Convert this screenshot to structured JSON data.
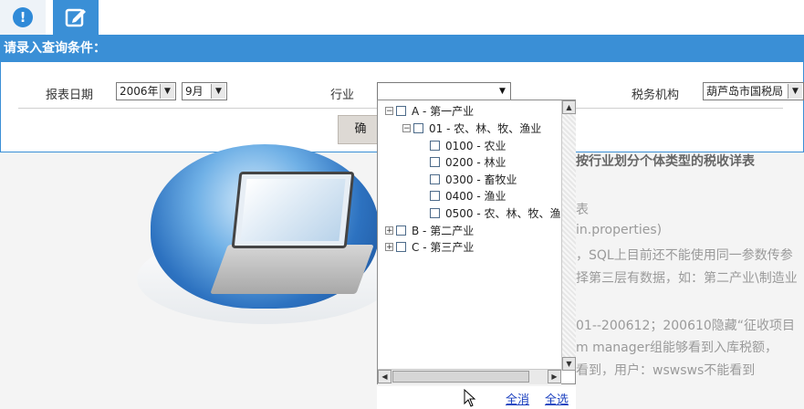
{
  "tabs": [
    {
      "name": "info-icon"
    },
    {
      "name": "edit-icon"
    }
  ],
  "panel": {
    "title": "请录入查询条件：",
    "fields": {
      "date_label": "报表日期",
      "year_value": "2006年",
      "month_value": "9月",
      "industry_label": "行业",
      "industry_value": "",
      "tax_office_label": "税务机构",
      "tax_office_value": "葫芦岛市国税局"
    },
    "query_button_partial": "确"
  },
  "background_content": {
    "title_partial": "按行业划分个体类型的税收详表",
    "lines": [
      "表",
      "in.properties)",
      "，SQL上目前还不能使用同一参数传参",
      "择第三层有数据，如：第二产业\\制造业",
      "01--200612；200610隐藏“征收项目",
      "m manager组能够看到入库税额，",
      "看到，用户：wswsws不能看到"
    ]
  },
  "industry_tree": {
    "nodes": [
      {
        "label": "A - 第一产业",
        "toggle": "−",
        "level": 0
      },
      {
        "label": "01 - 农、林、牧、渔业",
        "toggle": "−",
        "level": 1
      },
      {
        "label": "0100 - 农业",
        "toggle": "",
        "level": 2
      },
      {
        "label": "0200 - 林业",
        "toggle": "",
        "level": 2
      },
      {
        "label": "0300 - 畜牧业",
        "toggle": "",
        "level": 2
      },
      {
        "label": "0400 - 渔业",
        "toggle": "",
        "level": 2
      },
      {
        "label": "0500 - 农、林、牧、渔",
        "toggle": "",
        "level": 2
      },
      {
        "label": "B - 第二产业",
        "toggle": "+",
        "level": 0
      },
      {
        "label": "C - 第三产业",
        "toggle": "+",
        "level": 0
      }
    ],
    "cancel_all": "全消",
    "select_all": "全选"
  },
  "colors": {
    "accent": "#3a8fd6",
    "link": "#1a3fbf"
  }
}
